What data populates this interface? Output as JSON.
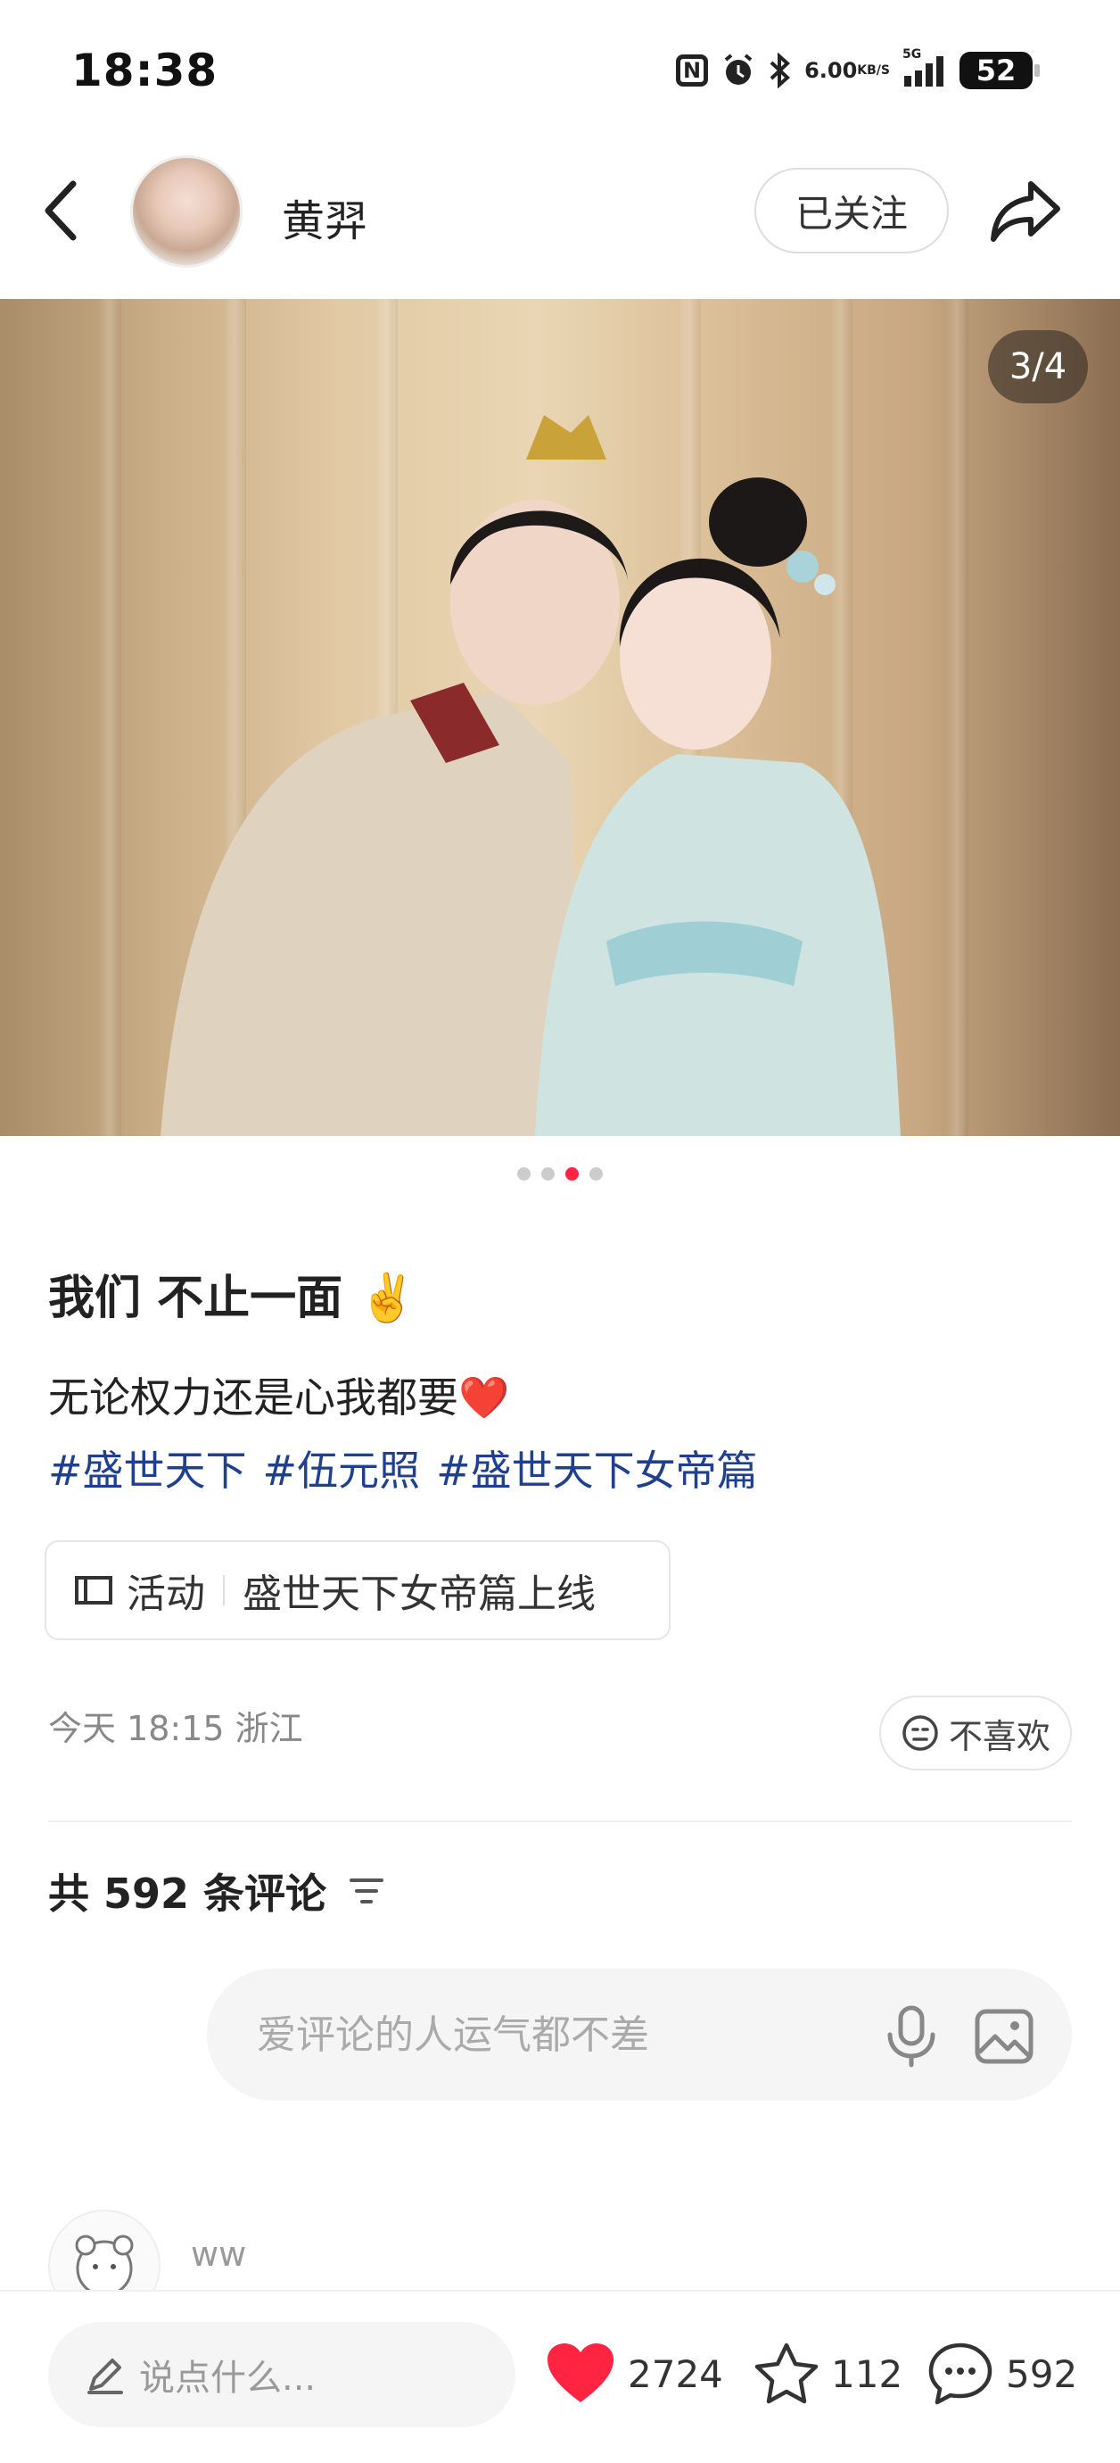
{
  "status_bar": {
    "time": "18:38",
    "speed_value": "6.00",
    "speed_unit": "KB/S",
    "network": "5G",
    "battery": "52",
    "icons": [
      "nfc-icon",
      "alarm-icon",
      "bluetooth-icon",
      "signal-icon",
      "battery-icon"
    ]
  },
  "header": {
    "author_name": "黄羿",
    "follow_label": "已关注"
  },
  "gallery": {
    "counter": "3/4",
    "current": 3,
    "total": 4
  },
  "post": {
    "title": "我们 不止一面 ✌️",
    "description": "无论权力还是心我都要❤️",
    "tags": [
      "#盛世天下",
      "#伍元照",
      "#盛世天下女帝篇"
    ],
    "activity_label": "活动",
    "activity_text": "盛世天下女帝篇上线",
    "meta": "今天 18:15 浙江",
    "dislike_label": "不喜欢"
  },
  "comments": {
    "count_text": "共 592 条评论",
    "input_placeholder": "爱评论的人运气都不差",
    "first_user": "ww"
  },
  "bottom_bar": {
    "say_placeholder": "说点什么...",
    "likes": "2724",
    "collects": "112",
    "comments": "592"
  },
  "colors": {
    "accent": "#ff2442",
    "tag": "#1f3f8f"
  }
}
